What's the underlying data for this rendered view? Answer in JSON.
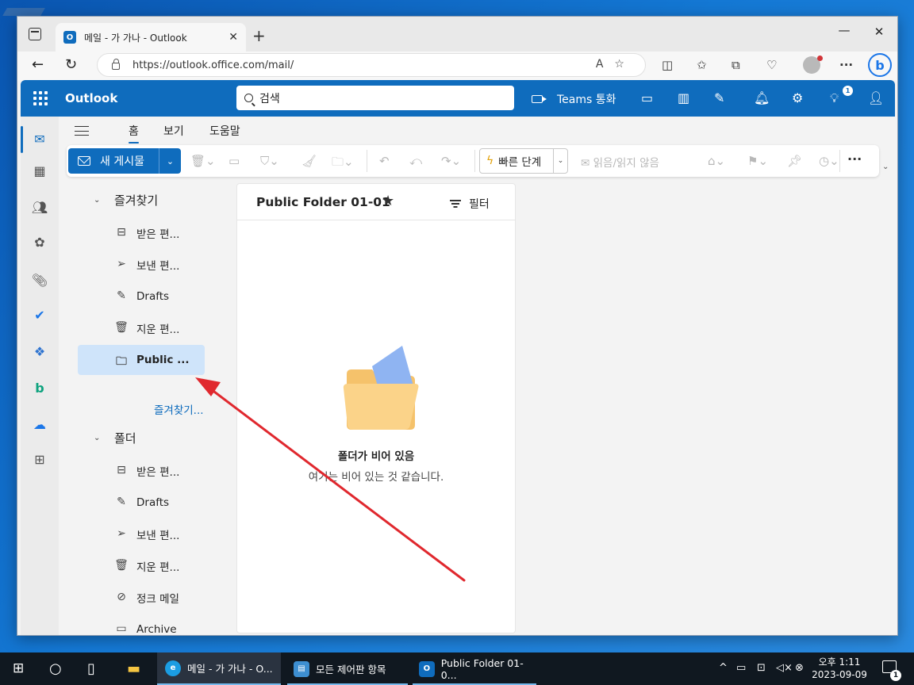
{
  "browser": {
    "tab_title": "메일 - 가 가나 - Outlook",
    "tab_close": "✕",
    "new_tab": "+",
    "url": "https://outlook.office.com/mail/",
    "window_min": "—",
    "window_max": "☐",
    "window_close": "✕"
  },
  "outlook": {
    "brand": "Outlook",
    "search_placeholder": "검색",
    "teams_label": "Teams 통화",
    "tips_badge": "1"
  },
  "ribbon": {
    "tabs": [
      "홈",
      "보기",
      "도움말"
    ],
    "new_mail": "새 게시물",
    "quick_steps": "빠른 단계",
    "read_unread": "읽음/읽지 않음",
    "more": "···"
  },
  "folders": {
    "favorites_header": "즐겨찾기",
    "favorites": [
      {
        "label": "받은 편...",
        "icon": "inbox-icon"
      },
      {
        "label": "보낸 편...",
        "icon": "send-icon"
      },
      {
        "label": "Drafts",
        "icon": "drafts-icon"
      },
      {
        "label": "지운 편...",
        "icon": "trash-icon"
      },
      {
        "label": "Public ...",
        "icon": "folder-icon",
        "selected": true
      }
    ],
    "add_favorite_link": "즐겨찾기...",
    "folders_header": "폴더",
    "folders": [
      {
        "label": "받은 편...",
        "icon": "inbox-icon"
      },
      {
        "label": "Drafts",
        "icon": "drafts-icon"
      },
      {
        "label": "보낸 편...",
        "icon": "send-icon"
      },
      {
        "label": "지운 편...",
        "icon": "trash-icon"
      },
      {
        "label": "정크 메일",
        "icon": "junk-icon"
      },
      {
        "label": "Archive",
        "icon": "archive-icon"
      }
    ]
  },
  "message_list": {
    "title": "Public Folder 01-01",
    "filter": "필터",
    "empty_title": "폴더가 비어 있음",
    "empty_subtitle": "여기는 비어 있는 것 같습니다."
  },
  "taskbar": {
    "items": [
      {
        "label": "메일 - 가 가나 - O...",
        "active": true
      },
      {
        "label": "모든 제어판 항목",
        "active": false
      },
      {
        "label": "Public Folder 01-0...",
        "active": false
      }
    ],
    "time": "오후 1:11",
    "date": "2023-09-09",
    "notification_count": "1"
  },
  "colors": {
    "outlook_blue": "#0f6cbd",
    "selection": "#cfe4fa",
    "annotation_arrow": "#e0282e"
  }
}
